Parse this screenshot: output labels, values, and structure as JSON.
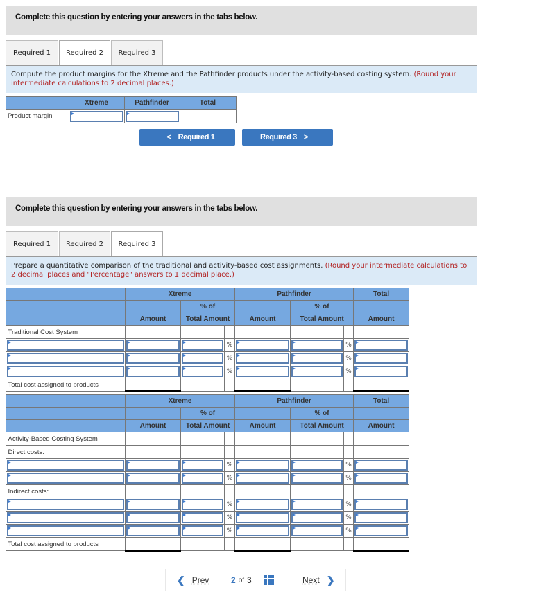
{
  "panel1": {
    "header": "Complete this question by entering your answers in the tabs below.",
    "tabs": [
      {
        "label": "Required 1",
        "active": false
      },
      {
        "label": "Required 2",
        "active": true
      },
      {
        "label": "Required 3",
        "active": false
      }
    ],
    "instruction": "Compute the product margins for the Xtreme and the Pathfinder products under the activity-based costing system.",
    "instruction_note": "(Round your intermediate calculations to 2 decimal places.)",
    "table": {
      "columns": [
        "",
        "Xtreme",
        "Pathfinder",
        "Total"
      ],
      "rows": [
        {
          "label": "Product margin",
          "values": [
            "",
            "",
            ""
          ]
        }
      ]
    },
    "prev_button": "Required 1",
    "next_button": "Required 3",
    "prev_icon": "chevron-left-icon",
    "next_icon": "chevron-right-icon"
  },
  "panel2": {
    "header": "Complete this question by entering your answers in the tabs below.",
    "tabs": [
      {
        "label": "Required 1",
        "active": false
      },
      {
        "label": "Required 2",
        "active": false
      },
      {
        "label": "Required 3",
        "active": true
      }
    ],
    "instruction": "Prepare a quantitative comparison of the traditional and activity-based cost assignments.",
    "instruction_note": "(Round your intermediate calculations to 2 decimal places and \"Percentage\" answers to 1 decimal place.)",
    "header_groups": {
      "xtreme": "Xtreme",
      "pathfinder": "Pathfinder",
      "total": "Total"
    },
    "header_sub": {
      "pct_of": "% of",
      "amount": "Amount",
      "total_amount": "Total Amount"
    },
    "percent_symbol": "%",
    "traditional": {
      "section_label": "Traditional Cost System",
      "input_rows": 3,
      "total_label": "Total cost assigned to products"
    },
    "abc": {
      "section_label": "Activity-Based Costing System",
      "direct_label": "Direct costs:",
      "direct_rows": 2,
      "indirect_label": "Indirect costs:",
      "indirect_rows": 3,
      "total_label": "Total cost assigned to products"
    }
  },
  "footer": {
    "prev_label": "Prev",
    "next_label": "Next",
    "current_page": "2",
    "of_label": "of",
    "total_pages": "3",
    "grid_icon": "grid-icon"
  },
  "colors": {
    "header_bg": "#e0e0e0",
    "instruction_bg": "#dbeaf7",
    "table_header_bg": "#76a8e0",
    "button_bg": "#3a77bf",
    "note_red": "#b22222"
  }
}
